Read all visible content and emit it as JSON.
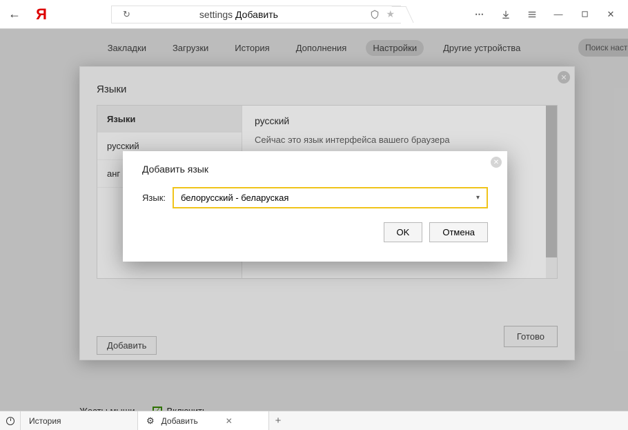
{
  "address": {
    "prefix": "settings",
    "strong": "Добавить"
  },
  "nav": {
    "tabs": [
      "Закладки",
      "Загрузки",
      "История",
      "Дополнения",
      "Настройки",
      "Другие устройства"
    ],
    "active_index": 4,
    "search_placeholder": "Поиск настр"
  },
  "languages_modal": {
    "title": "Языки",
    "sidebar_header": "Языки",
    "items": [
      "русский",
      "анг"
    ],
    "selected_name": "русский",
    "selected_desc": "Сейчас это язык интерфейса вашего браузера",
    "add_button": "Добавить",
    "done_button": "Готово"
  },
  "add_lang_modal": {
    "title": "Добавить язык",
    "field_label": "Язык:",
    "selected_value": "белорусский - беларуская",
    "ok": "OK",
    "cancel": "Отмена"
  },
  "mouse_gestures": {
    "label": "Жесты мыши",
    "checkbox_label": "Включить"
  },
  "taskbar": {
    "history": "История",
    "tab2": "Добавить"
  }
}
